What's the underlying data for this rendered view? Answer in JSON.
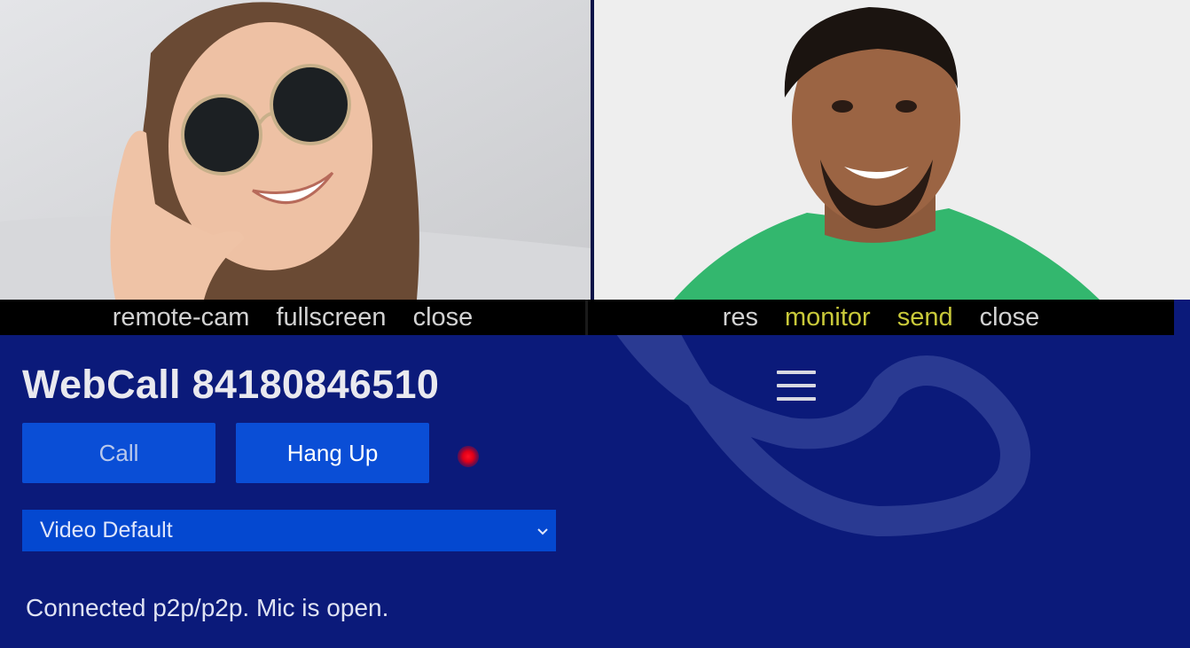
{
  "remote_video": {
    "toolbar": {
      "remote_cam": "remote-cam",
      "fullscreen": "fullscreen",
      "close": "close"
    }
  },
  "local_video": {
    "toolbar": {
      "res": "res",
      "monitor": "monitor",
      "send": "send",
      "close": "close"
    },
    "active_color": "#c9c93a"
  },
  "header": {
    "title": "WebCall 84180846510"
  },
  "controls": {
    "call_label": "Call",
    "hangup_label": "Hang Up"
  },
  "video_select": {
    "selected": "Video Default"
  },
  "status": {
    "text": "Connected p2p/p2p. Mic is open."
  },
  "icons": {
    "menu": "hamburger-menu-icon",
    "select_arrow": "chevron-down-icon",
    "recording": "recording-indicator-icon"
  },
  "colors": {
    "panel_bg": "#0b1a7a",
    "button_bg": "#0a4ed6",
    "select_bg": "#0448d0",
    "indicator": "#ff1024"
  }
}
